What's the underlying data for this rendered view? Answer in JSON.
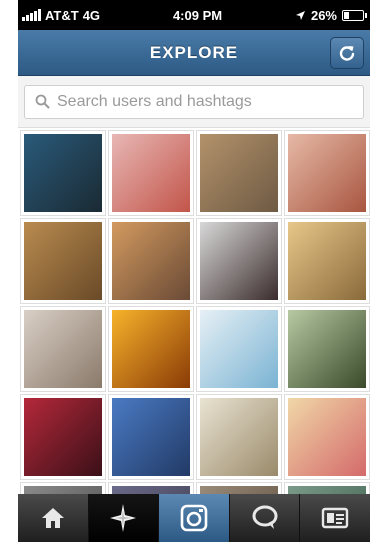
{
  "status_bar": {
    "carrier": "AT&T",
    "network": "4G",
    "time": "4:09 PM",
    "battery": "26%",
    "battery_level": 0.26
  },
  "nav": {
    "title": "EXPLORE",
    "refresh_icon": "refresh-icon"
  },
  "search": {
    "placeholder": "Search users and hashtags",
    "icon": "search-icon"
  },
  "grid": {
    "tiles": [
      {
        "name": "photo-harbor-view",
        "colors": [
          "#2a5a7a",
          "#1a2a33"
        ]
      },
      {
        "name": "photo-nail-art",
        "colors": [
          "#e8b7b4",
          "#c2554a"
        ]
      },
      {
        "name": "photo-desk-items",
        "colors": [
          "#b3926b",
          "#6e5a43"
        ]
      },
      {
        "name": "photo-tv-cartoon",
        "colors": [
          "#e6b9a6",
          "#a85640"
        ]
      },
      {
        "name": "photo-face-sketch",
        "colors": [
          "#b98b4f",
          "#6a4a28"
        ]
      },
      {
        "name": "photo-beach-sunset",
        "colors": [
          "#d39a5f",
          "#6a4a36"
        ]
      },
      {
        "name": "photo-portrait",
        "colors": [
          "#d8d8d8",
          "#3b2c2c"
        ]
      },
      {
        "name": "photo-cupcakes",
        "colors": [
          "#e8c78a",
          "#8a6a3a"
        ]
      },
      {
        "name": "photo-fashion-collage",
        "colors": [
          "#d9cfc6",
          "#8a7a6a"
        ]
      },
      {
        "name": "photo-golden-sun",
        "colors": [
          "#f7b32b",
          "#8a3a06"
        ]
      },
      {
        "name": "photo-rainbow-nails",
        "colors": [
          "#e6f0f5",
          "#7ab3d3"
        ]
      },
      {
        "name": "photo-car-pose",
        "colors": [
          "#b7c9a3",
          "#3a4a2a"
        ]
      },
      {
        "name": "photo-sneakers",
        "colors": [
          "#b4283a",
          "#3a1018"
        ]
      },
      {
        "name": "photo-city-pier",
        "colors": [
          "#4a7ac3",
          "#223a66"
        ]
      },
      {
        "name": "photo-dessert-cup",
        "colors": [
          "#e9e3d2",
          "#9a8a6a"
        ]
      },
      {
        "name": "photo-macarons",
        "colors": [
          "#f0d7a8",
          "#d46a6a"
        ]
      },
      {
        "name": "photo-partial-1",
        "colors": [
          "#8a8a8a",
          "#4a4a4a"
        ]
      },
      {
        "name": "photo-partial-2",
        "colors": [
          "#6a6a8a",
          "#3a3a4a"
        ]
      },
      {
        "name": "photo-partial-3",
        "colors": [
          "#9a8a7a",
          "#5a4a3a"
        ]
      },
      {
        "name": "photo-partial-4",
        "colors": [
          "#7a9a8a",
          "#3a5a4a"
        ]
      }
    ]
  },
  "tabs": [
    {
      "name": "tab-home",
      "icon": "home-icon"
    },
    {
      "name": "tab-explore",
      "icon": "explore-star-icon",
      "active": true
    },
    {
      "name": "tab-camera",
      "icon": "camera-icon"
    },
    {
      "name": "tab-news",
      "icon": "speech-bubble-icon"
    },
    {
      "name": "tab-profile",
      "icon": "profile-card-icon"
    }
  ]
}
